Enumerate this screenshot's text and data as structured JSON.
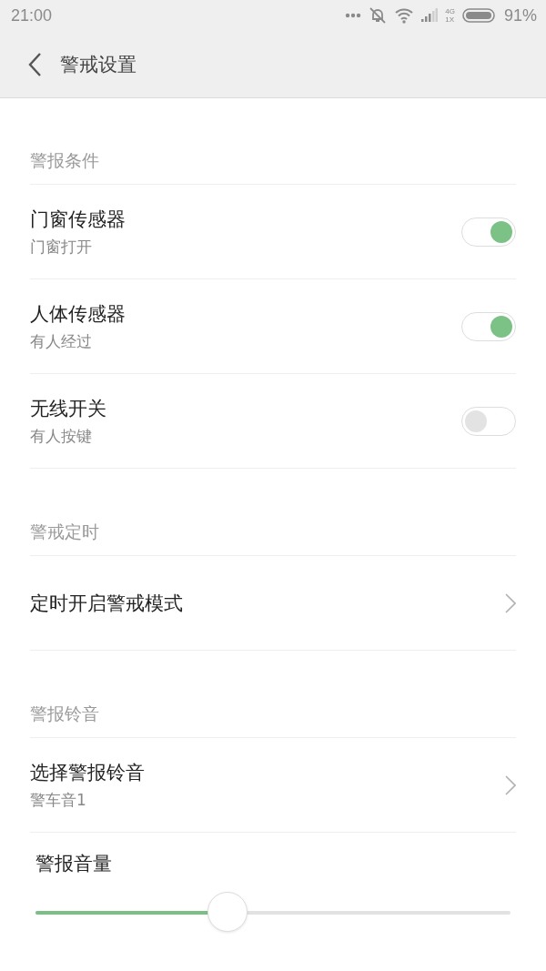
{
  "status_bar": {
    "time": "21:00",
    "network_type": "4G",
    "network_type_secondary": "1X",
    "battery": "91%"
  },
  "header": {
    "title": "警戒设置"
  },
  "sections": [
    {
      "title": "警报条件",
      "items": [
        {
          "kind": "toggle",
          "title": "门窗传感器",
          "subtitle": "门窗打开",
          "on": true
        },
        {
          "kind": "toggle",
          "title": "人体传感器",
          "subtitle": "有人经过",
          "on": true
        },
        {
          "kind": "toggle",
          "title": "无线开关",
          "subtitle": "有人按键",
          "on": false
        }
      ]
    },
    {
      "title": "警戒定时",
      "items": [
        {
          "kind": "link",
          "title": "定时开启警戒模式"
        }
      ]
    },
    {
      "title": "警报铃音",
      "items": [
        {
          "kind": "link",
          "title": "选择警报铃音",
          "subtitle": "警车音1"
        }
      ]
    }
  ],
  "volume": {
    "label": "警报音量",
    "level": 0.405
  }
}
